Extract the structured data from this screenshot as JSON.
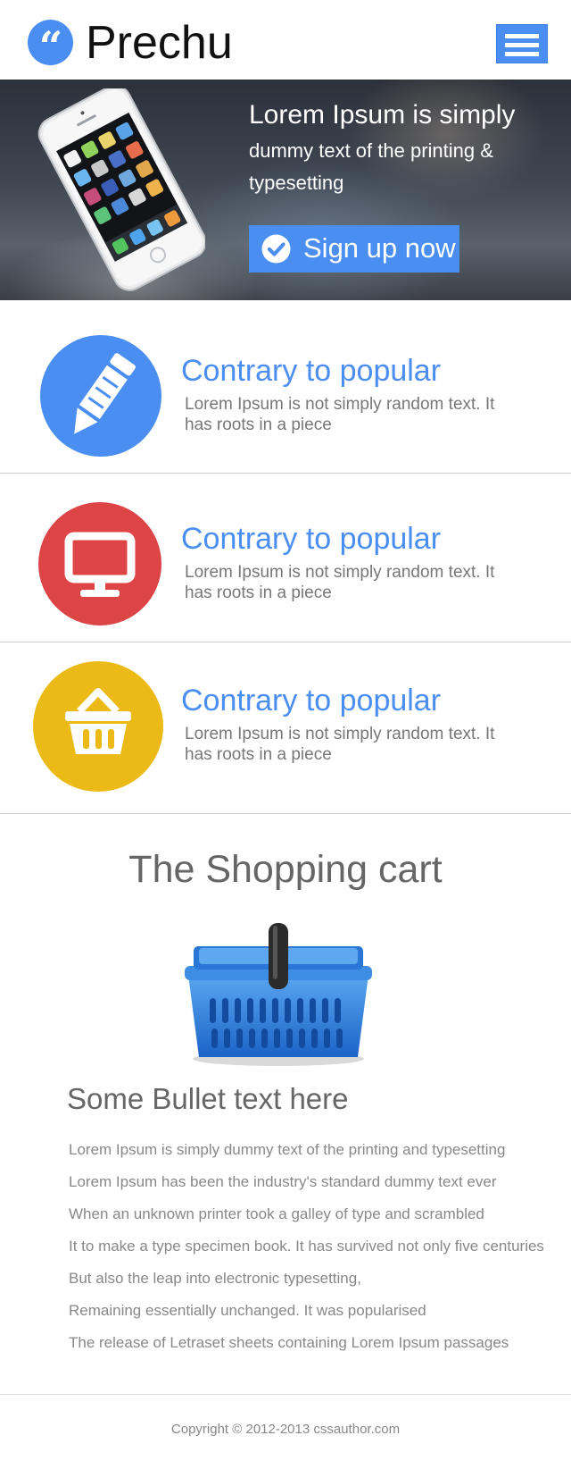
{
  "header": {
    "logo_glyph": "“",
    "brand": "Prechu",
    "menu_icon": "hamburger-menu-icon"
  },
  "hero": {
    "title": "Lorem Ipsum is simply",
    "subtitle": "dummy text of the printing & typesetting",
    "signup_label": "Sign up now",
    "signup_icon": "check-circle-icon",
    "image": "smartphone"
  },
  "features": [
    {
      "icon": "pencil-icon",
      "color": "#4a8ef2",
      "title": "Contrary to popular",
      "text": "Lorem Ipsum is not simply random text. It has roots in a piece"
    },
    {
      "icon": "monitor-icon",
      "color": "#dc4446",
      "title": "Contrary to popular",
      "text": "Lorem Ipsum is not simply random text. It has roots in a piece"
    },
    {
      "icon": "basket-icon",
      "color": "#ebba16",
      "title": "Contrary to popular",
      "text": "Lorem Ipsum is not simply random text. It has roots in a piece"
    }
  ],
  "shopping": {
    "title": "The Shopping cart",
    "bullet_title": "Some Bullet text here",
    "bullets": [
      "Lorem Ipsum is simply dummy text of the printing and typesetting",
      "Lorem Ipsum has been the industry's standard dummy text ever",
      "When an unknown printer took a galley of type and scrambled",
      "It to make a type specimen book. It has survived not only five centuries",
      "But also the leap into electronic typesetting,",
      "Remaining essentially unchanged. It was popularised",
      "The release of Letraset sheets containing Lorem Ipsum passages"
    ]
  },
  "footer": {
    "copyright": "Copyright © 2012-2013 cssauthor.com"
  },
  "colors": {
    "accent": "#4a8ef2",
    "red": "#dc4446",
    "yellow": "#ebba16"
  }
}
